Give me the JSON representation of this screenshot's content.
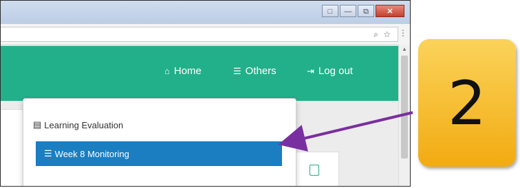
{
  "window": {
    "buttons": [
      "□",
      "—",
      "⧉",
      "✕"
    ]
  },
  "toolbar": {
    "zoom_icon": "⌕",
    "star_icon": "☆",
    "menu_icon": "⋮"
  },
  "navbar": {
    "items": [
      {
        "icon": "home-icon",
        "glyph": "⌂",
        "label": "Home"
      },
      {
        "icon": "database-icon",
        "glyph": "☰",
        "label": "Others"
      },
      {
        "icon": "logout-icon",
        "glyph": "⇥",
        "label": "Log out"
      }
    ]
  },
  "dropdown": {
    "items": [
      {
        "icon": "list-icon",
        "glyph": "▤",
        "label": "Learning Evaluation",
        "active": false
      },
      {
        "icon": "sliders-icon",
        "glyph": "☰",
        "label": "Week 8 Monitoring",
        "active": true
      }
    ]
  },
  "callout": {
    "step": "2",
    "colors": {
      "badge": "#f2ab12",
      "arrow": "#7a2fa0"
    }
  },
  "colors": {
    "navbar": "#22b08a",
    "active_item": "#1a7ec1"
  }
}
